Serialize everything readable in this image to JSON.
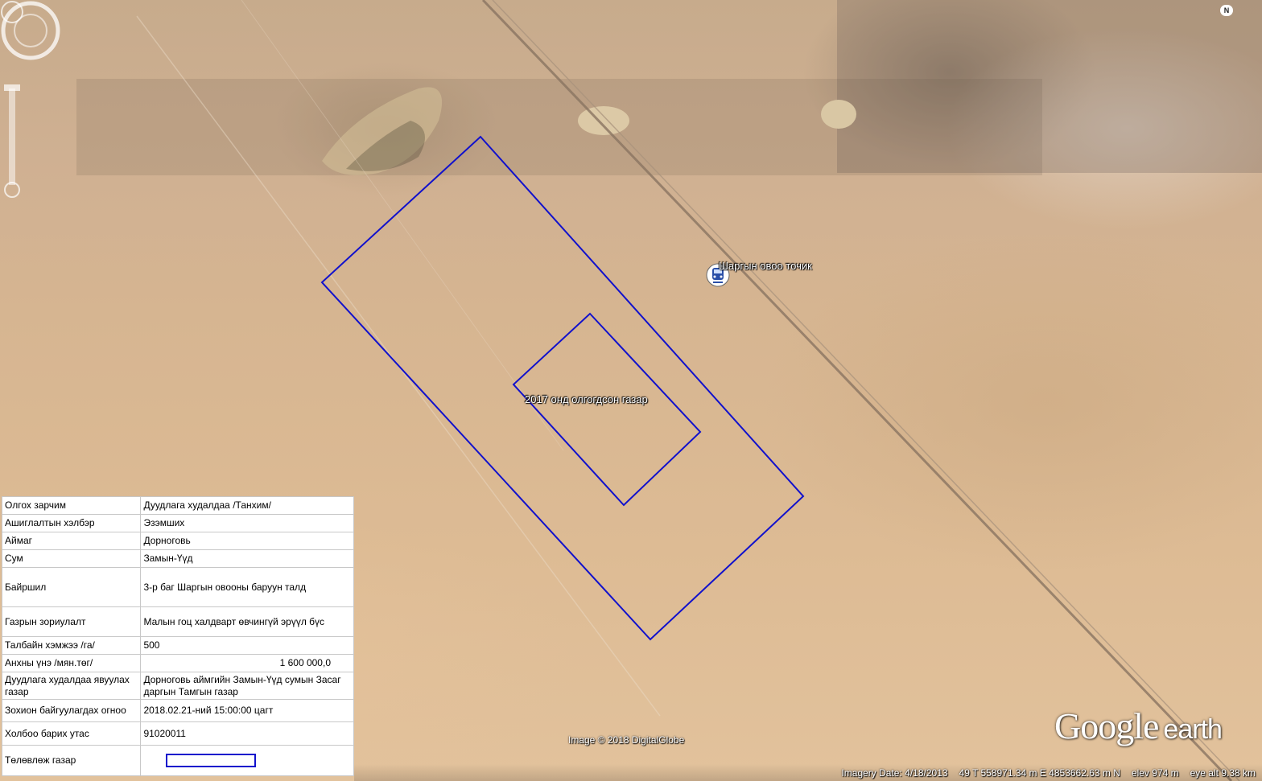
{
  "map": {
    "station_label": "Шаргын овоо точик",
    "area_2017_label": "2017 онд олгогдсон газар",
    "copyright": "Image © 2018 DigitalGlobe",
    "logo_google": "Google",
    "logo_earth": "earth",
    "compass_north": "N",
    "boundary_color": "#1111cc",
    "station_icon": "train-station-icon"
  },
  "status": {
    "imagery_date": "Imagery Date: 4/18/2013",
    "coordinates": "49 T 558971.34 m E 4853662.63 m N",
    "elevation": "elev   974 m",
    "eye_alt": "eye alt   9.38 km"
  },
  "info": {
    "rows": [
      {
        "label": "Олгох зарчим",
        "value": "Дуудлага худалдаа /Танхим/"
      },
      {
        "label": "Ашиглалтын хэлбэр",
        "value": "Эзэмших"
      },
      {
        "label": "Аймаг",
        "value": "Дорноговь"
      },
      {
        "label": "Сум",
        "value": "Замын-Үүд"
      },
      {
        "label": "Байршил",
        "value": "3-р баг Шаргын овооны баруун талд"
      },
      {
        "label": "Газрын зориулалт",
        "value": "Малын гоц халдварт өвчингүй эрүүл бүс"
      },
      {
        "label": "Талбайн хэмжээ /га/",
        "value": "500"
      },
      {
        "label": "Анхны үнэ /мян.төг/",
        "value": "1 600 000,0"
      },
      {
        "label": "Дуудлага худалдаа явуулах газар",
        "value": "Дорноговь аймгийн Замын-Үүд сумын Засаг даргын Тамгын газар"
      },
      {
        "label": "Зохион байгуулагдах огноо",
        "value": "2018.02.21-ний 15:00:00 цагт"
      },
      {
        "label": "Холбоо барих утас",
        "value": "91020011"
      },
      {
        "label": "Төлөвлөж газар",
        "value": ""
      }
    ]
  }
}
